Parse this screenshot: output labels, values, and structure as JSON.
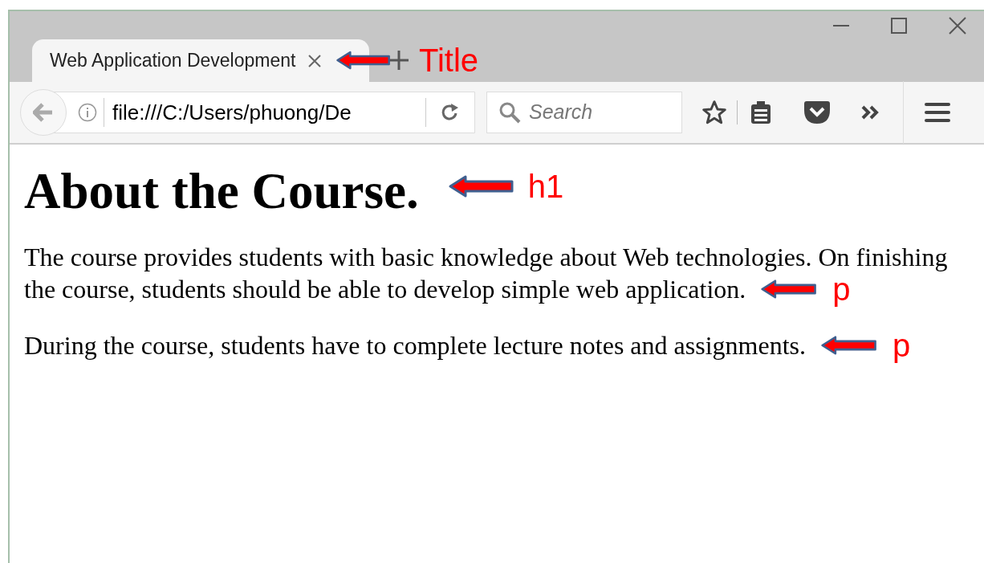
{
  "browser": {
    "tab": {
      "title": "Web Application Development",
      "selected": true
    },
    "address": "file:///C:/Users/phuong/De",
    "search": {
      "placeholder": "Search"
    }
  },
  "page": {
    "heading": "About the Course.",
    "paragraphs": [
      {
        "lines": [
          "The course provides students with basic knowledge about Web technologies. On finishing",
          "the course, students should be able to develop simple web application."
        ]
      },
      {
        "lines": [
          "During the course, students have to complete lecture notes and assignments."
        ]
      }
    ]
  },
  "annotations": {
    "tab": "Title",
    "heading": "h1",
    "paragraphs": [
      "p",
      "p"
    ]
  }
}
